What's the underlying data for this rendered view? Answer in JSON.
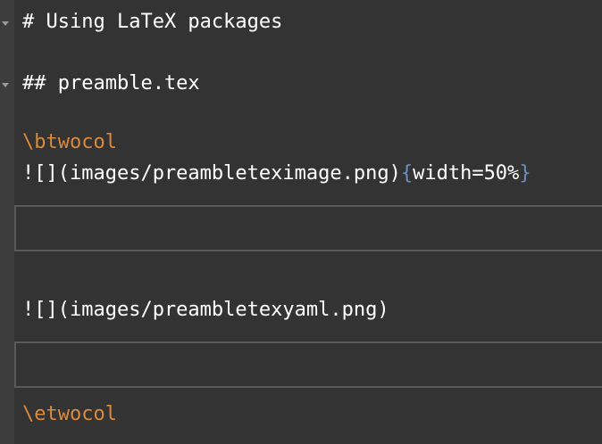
{
  "lines": {
    "h1": "# Using LaTeX packages",
    "h2": "## preamble.tex",
    "btwocol": "\\btwocol",
    "img1_prefix": "![](images/preambleteximage.png)",
    "img1_brace_open": "{",
    "img1_attr": "width=50%",
    "img1_brace_close": "}",
    "img2": "![](images/preambletexyaml.png)",
    "etwocol": "\\etwocol"
  },
  "colors": {
    "background": "#333333",
    "gutter": "#3d3d3d",
    "text": "#ffffff",
    "latex_command": "#d98a3d",
    "brace": "#6a8fbf",
    "output_border": "#5a5a5a"
  },
  "icons": {
    "fold": "chevron-down-icon"
  }
}
